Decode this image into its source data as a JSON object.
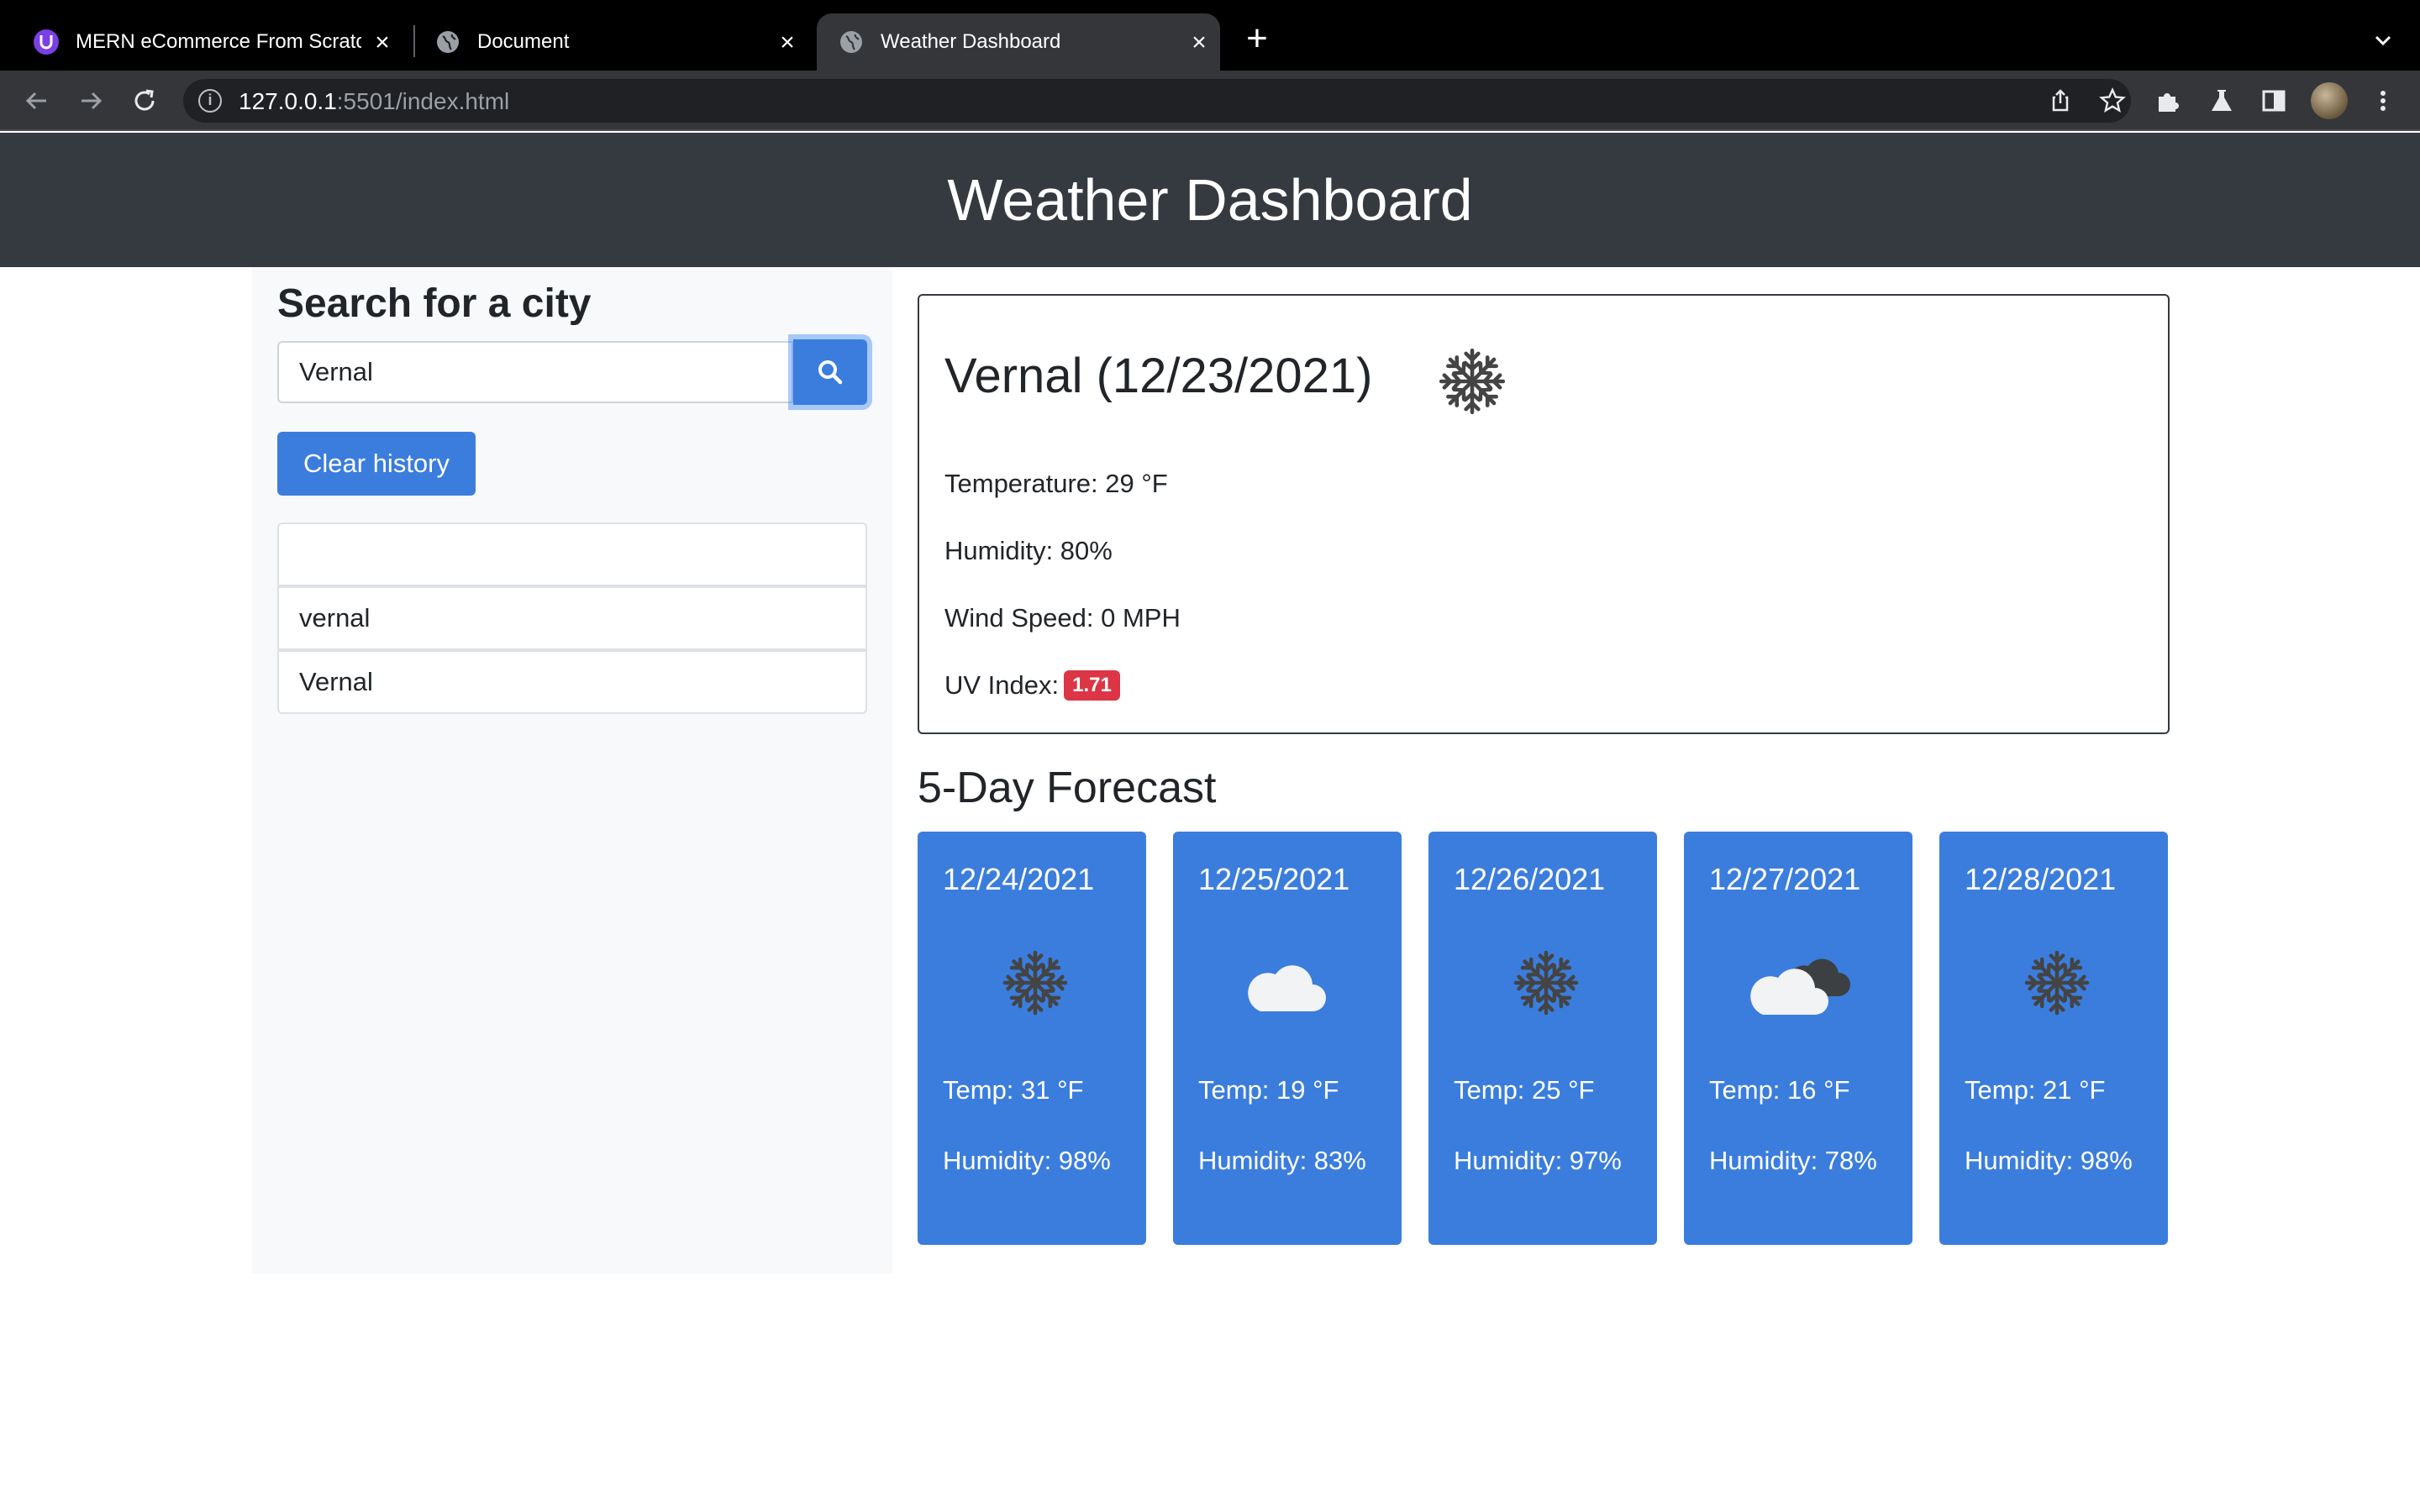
{
  "browser": {
    "tabs": [
      {
        "title": "MERN eCommerce From Scratch",
        "active": false
      },
      {
        "title": "Document",
        "active": false
      },
      {
        "title": "Weather Dashboard",
        "active": true
      }
    ],
    "url_host": "127.0.0.1",
    "url_path": ":5501/index.html"
  },
  "header": {
    "title": "Weather Dashboard"
  },
  "sidebar": {
    "heading": "Search for a city",
    "search_value": "Vernal",
    "clear_label": "Clear history",
    "history": [
      "",
      "vernal",
      "Vernal"
    ]
  },
  "current": {
    "city_date": "Vernal (12/23/2021)",
    "icon": "snow-icon",
    "temperature": "Temperature: 29 °F",
    "humidity": "Humidity: 80%",
    "wind": "Wind Speed: 0 MPH",
    "uv_label": "UV Index:",
    "uv_value": "1.71",
    "uv_color": "#dc3545"
  },
  "forecast": {
    "title": "5-Day Forecast",
    "days": [
      {
        "date": "12/24/2021",
        "icon": "snow-icon",
        "temp": "Temp: 31 °F",
        "humidity": "Humidity: 98%"
      },
      {
        "date": "12/25/2021",
        "icon": "cloud-icon",
        "temp": "Temp: 19 °F",
        "humidity": "Humidity: 83%"
      },
      {
        "date": "12/26/2021",
        "icon": "snow-icon",
        "temp": "Temp: 25 °F",
        "humidity": "Humidity: 97%"
      },
      {
        "date": "12/27/2021",
        "icon": "broken-clouds-icon",
        "temp": "Temp: 16 °F",
        "humidity": "Humidity: 78%"
      },
      {
        "date": "12/28/2021",
        "icon": "snow-icon",
        "temp": "Temp: 21 °F",
        "humidity": "Humidity: 98%"
      }
    ]
  },
  "colors": {
    "primary": "#3b7ddd",
    "header_bg": "#343a40",
    "sidebar_bg": "#f8f9fa"
  }
}
